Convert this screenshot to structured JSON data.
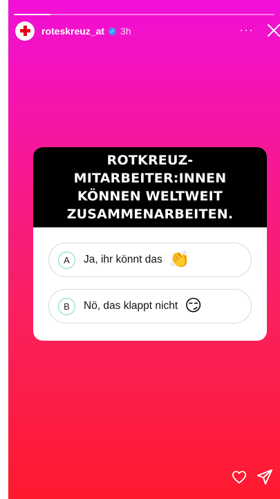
{
  "story": {
    "progress": 0.14,
    "username": "roteskreuz_at",
    "time": "3h",
    "more_label": "···"
  },
  "quiz": {
    "question": "ROTKREUZ-MITARBEITER:INNEN KÖNNEN WELTWEIT ZUSAMMENARBEITEN.",
    "options": [
      {
        "letter": "A",
        "label": "Ja, ihr könnt das",
        "emoji": "👏"
      },
      {
        "letter": "B",
        "label": "Nö, das klappt nicht",
        "emoji": "😏"
      }
    ]
  },
  "icons": {
    "avatar": "red-cross-logo",
    "verified": "verified-badge-icon",
    "close": "close-icon",
    "like": "heart-icon",
    "share": "send-icon"
  },
  "colors": {
    "gradient_top": "#f20fd8",
    "gradient_bottom": "#ff1a2e",
    "verified": "#3897f0",
    "brand_red": "#e30613"
  }
}
